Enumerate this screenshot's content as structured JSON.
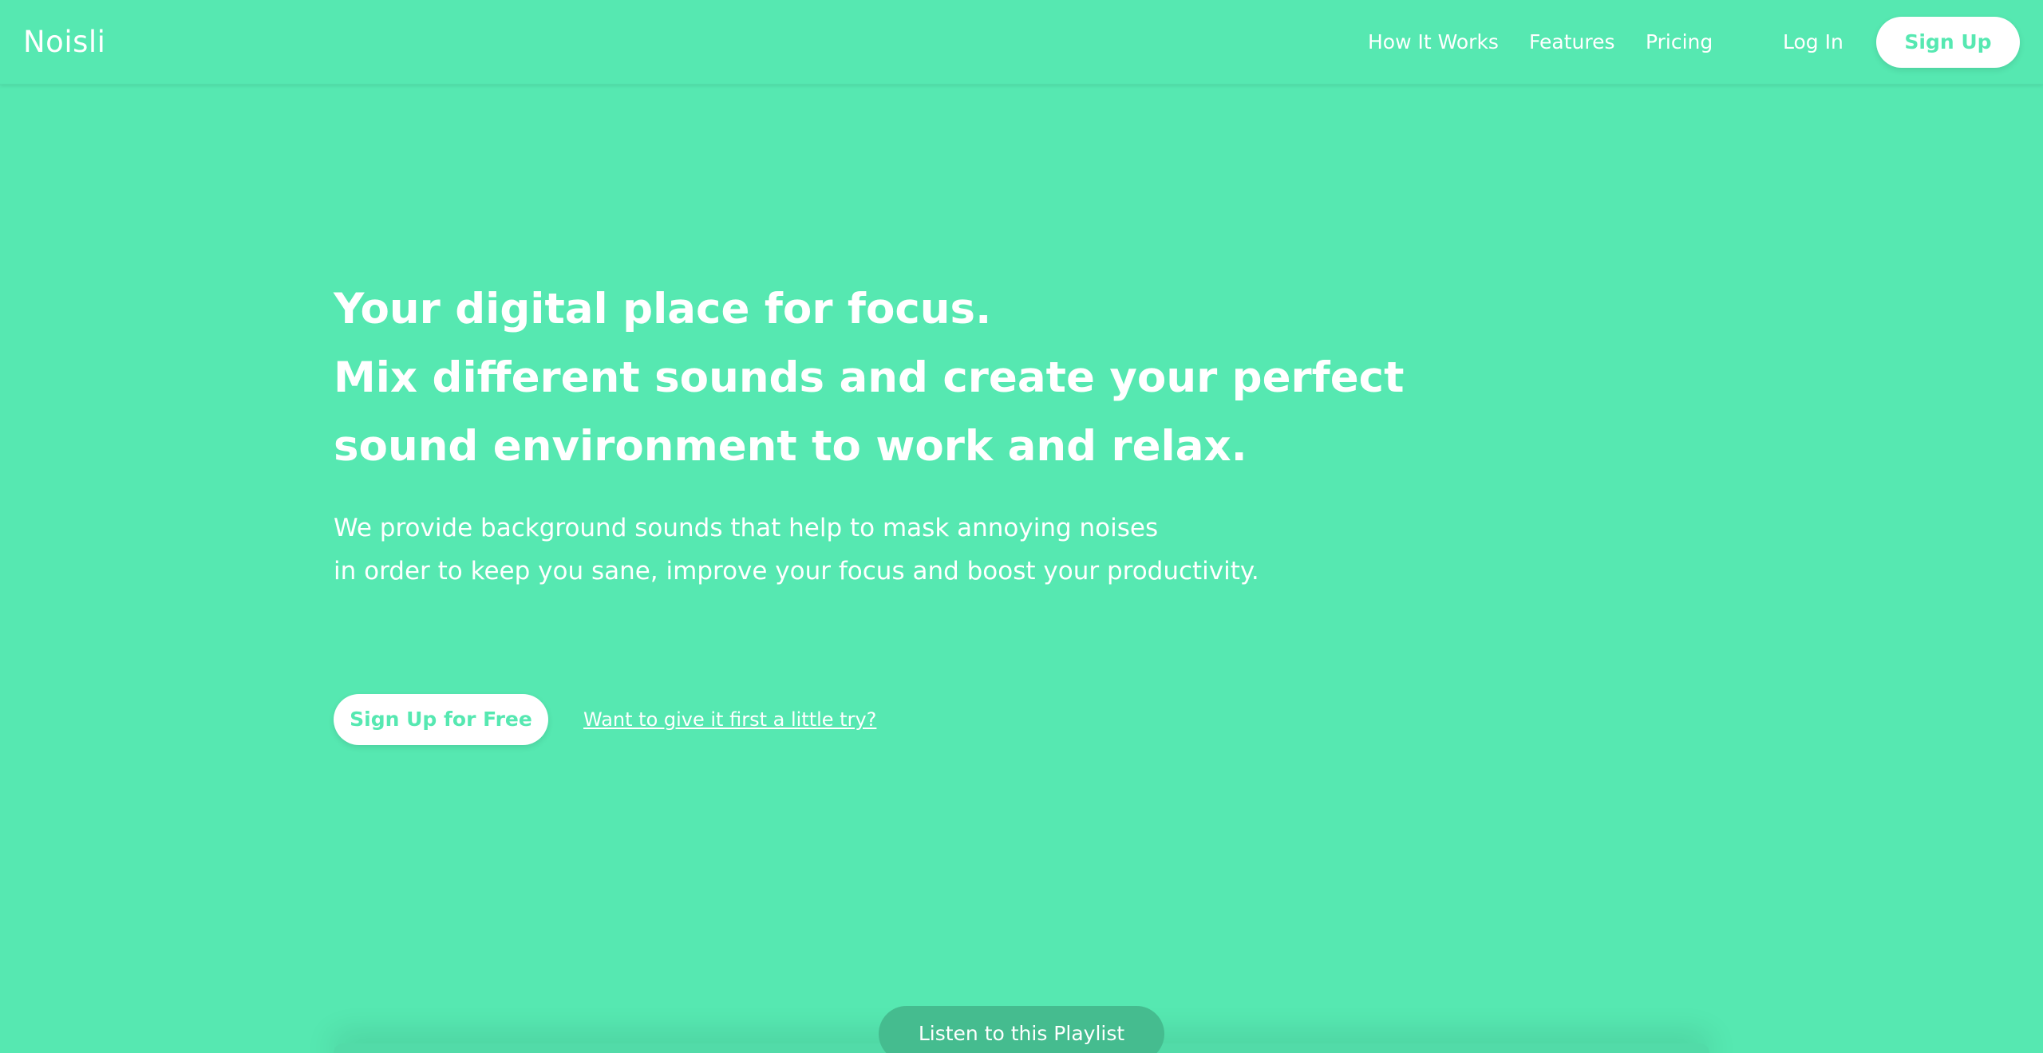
{
  "colors": {
    "background": "#56e8b1",
    "accent_text": "#56e8b1",
    "button_bg": "#ffffff",
    "playlist_button_bg": "#45bc8f"
  },
  "header": {
    "logo": "Noisli",
    "nav": {
      "how_it_works": "How It Works",
      "features": "Features",
      "pricing": "Pricing",
      "log_in": "Log In",
      "sign_up": "Sign Up"
    }
  },
  "hero": {
    "title_lines": [
      "Your digital place for focus.",
      "Mix different sounds and create your perfect",
      "sound environment to work and relax."
    ],
    "subtitle_lines": [
      "We provide background sounds that help to mask annoying noises",
      "in order to keep you sane, improve your focus and boost your productivity."
    ],
    "cta_primary": "Sign Up for Free",
    "cta_secondary": "Want to give it first a little try?"
  },
  "player": {
    "playlist_button": "Listen to this Playlist"
  }
}
